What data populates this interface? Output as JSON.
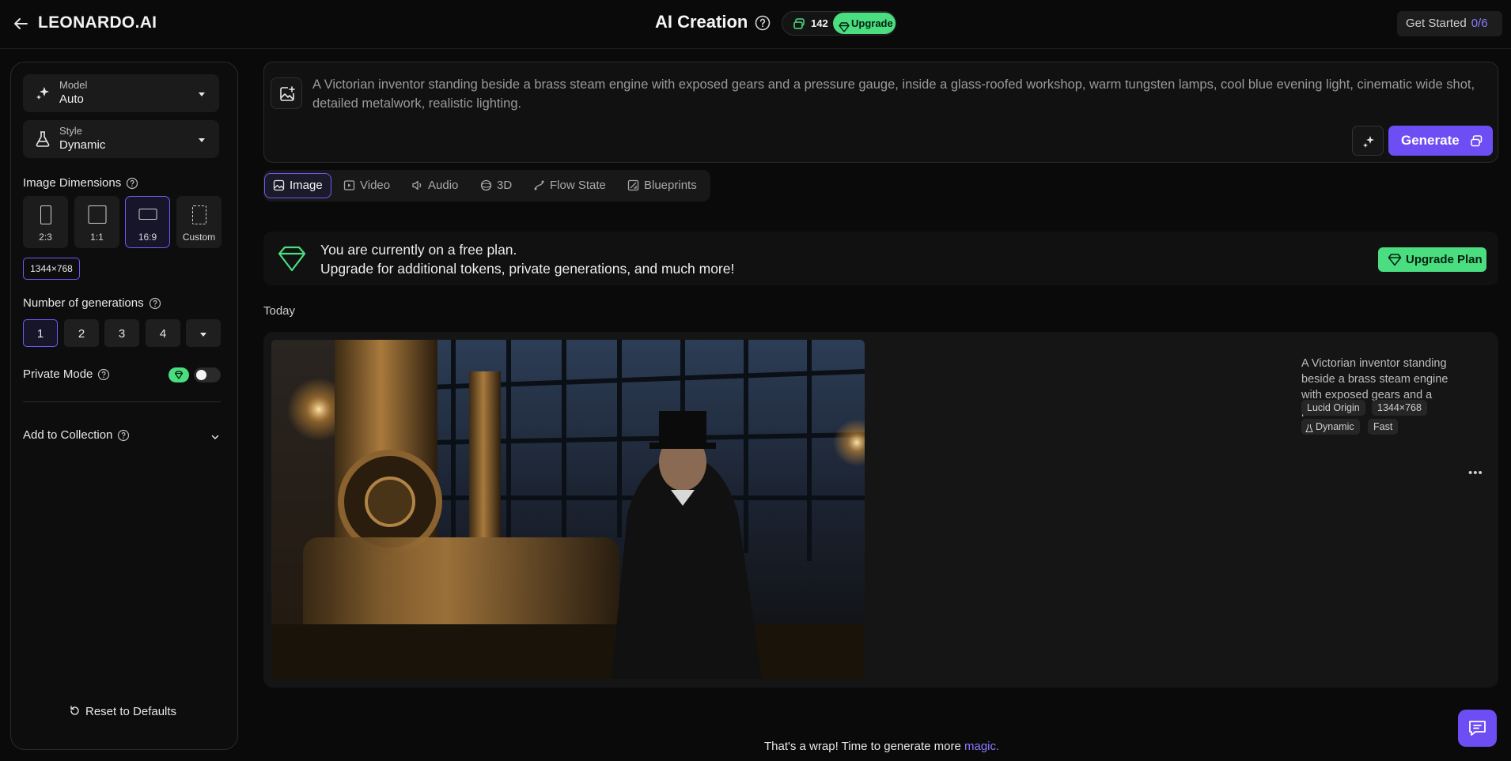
{
  "header": {
    "logo": "LEONARDO.AI",
    "title": "AI Creation",
    "tokens": "142",
    "upgrade_label": "Upgrade",
    "get_started_label": "Get Started",
    "get_started_progress": "0/6"
  },
  "sidebar": {
    "model": {
      "label": "Model",
      "value": "Auto"
    },
    "style": {
      "label": "Style",
      "value": "Dynamic"
    },
    "image_dimensions_label": "Image Dimensions",
    "dimensions": [
      {
        "label": "2:3",
        "active": false
      },
      {
        "label": "1:1",
        "active": false
      },
      {
        "label": "16:9",
        "active": true
      },
      {
        "label": "Custom",
        "active": false
      }
    ],
    "resolution": "1344×768",
    "num_generations_label": "Number of generations",
    "generations": [
      "1",
      "2",
      "3",
      "4"
    ],
    "generations_selected": "1",
    "private_mode_label": "Private Mode",
    "private_mode_on": false,
    "add_to_collection_label": "Add to Collection",
    "reset_label": "Reset to Defaults"
  },
  "prompt": {
    "text": "A Victorian inventor standing beside a brass steam engine with exposed gears and a pressure gauge, inside a glass-roofed workshop, warm tungsten lamps, cool blue evening light, cinematic wide shot, detailed metalwork, realistic lighting.",
    "generate_label": "Generate"
  },
  "tabs": [
    {
      "label": "Image",
      "icon": "image-icon",
      "active": true
    },
    {
      "label": "Video",
      "icon": "video-icon",
      "active": false
    },
    {
      "label": "Audio",
      "icon": "audio-icon",
      "active": false
    },
    {
      "label": "3D",
      "icon": "cube-icon",
      "active": false
    },
    {
      "label": "Flow State",
      "icon": "flow-icon",
      "active": false
    },
    {
      "label": "Blueprints",
      "icon": "blueprint-icon",
      "active": false
    }
  ],
  "banner": {
    "line1": "You are currently on a free plan.",
    "line2": "Upgrade for additional tokens, private generations, and much more!",
    "button_label": "Upgrade Plan"
  },
  "feed": {
    "section_label": "Today",
    "generation": {
      "prompt_excerpt": "A Victorian inventor standing beside a brass steam engine with exposed gears and a pressure...",
      "chips": [
        "Lucid Origin",
        "1344×768",
        "Dynamic",
        "Fast"
      ]
    }
  },
  "footer": {
    "text": "That's a wrap! Time to generate more",
    "link": "magic."
  },
  "colors": {
    "accent": "#6d4ef5",
    "accent_border": "#6d5cf5",
    "upgrade_green": "#4ade80",
    "background": "#0a0a0a"
  }
}
